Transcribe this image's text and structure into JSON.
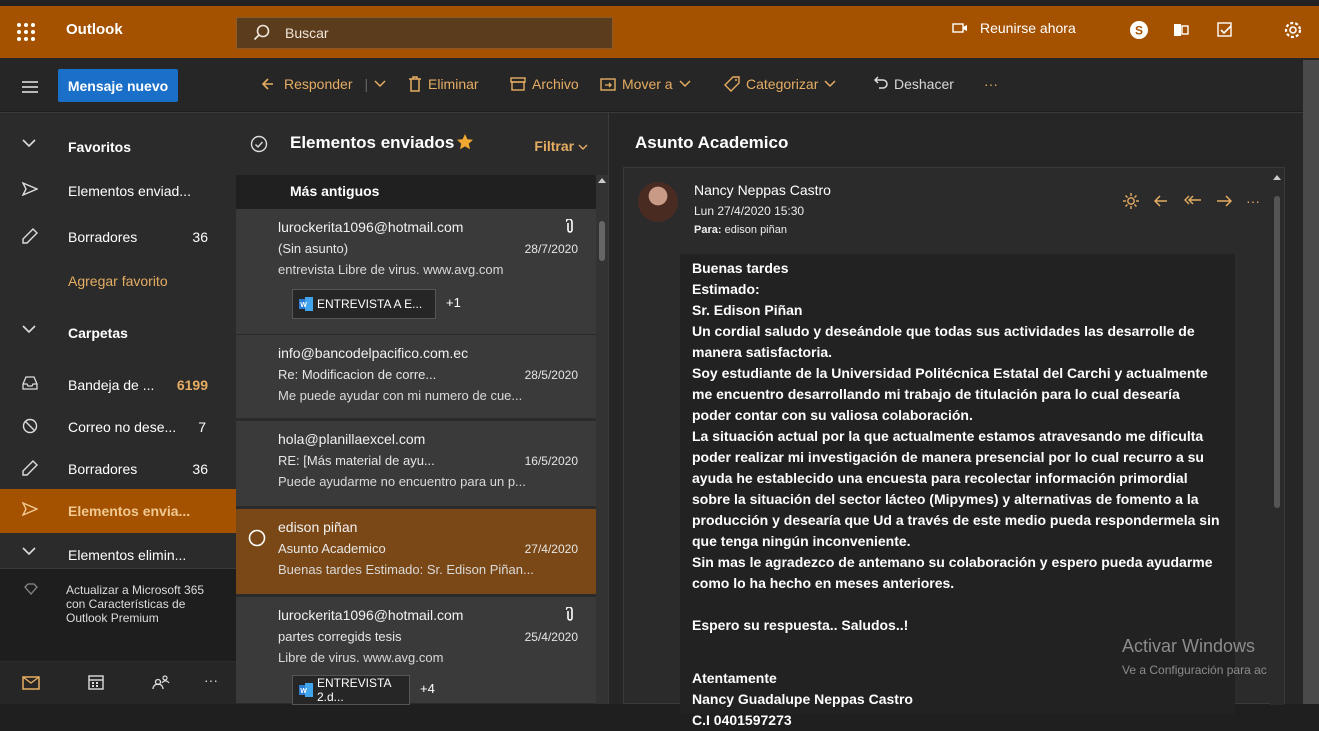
{
  "app": {
    "brand": "Outlook"
  },
  "search": {
    "placeholder": "Buscar"
  },
  "topbar": {
    "meet_label": "Reunirse ahora",
    "icons": [
      "meet-now-icon",
      "skype-icon",
      "office-icon",
      "my-day-icon",
      "settings-icon"
    ]
  },
  "commands": {
    "new_message": "Mensaje nuevo",
    "reply": "Responder",
    "delete": "Eliminar",
    "archive": "Archivo",
    "move_to": "Mover a",
    "categorize": "Categorizar",
    "undo": "Deshacer",
    "more": "···"
  },
  "sidebar": {
    "favorites_label": "Favoritos",
    "favorites": [
      {
        "label": "Elementos enviad...",
        "count": "",
        "icon": "send-icon"
      },
      {
        "label": "Borradores",
        "count": "36",
        "icon": "pencil-icon"
      }
    ],
    "add_favorite": "Agregar favorito",
    "folders_label": "Carpetas",
    "folders": [
      {
        "label": "Bandeja de ...",
        "count": "6199",
        "icon": "inbox-icon"
      },
      {
        "label": "Correo no dese...",
        "count": "7",
        "icon": "junk-icon"
      },
      {
        "label": "Borradores",
        "count": "36",
        "icon": "pencil-icon"
      },
      {
        "label": "Elementos envia...",
        "count": "",
        "icon": "send-icon"
      },
      {
        "label": "Elementos elimin...",
        "count": "",
        "icon": "chevron-down-icon"
      }
    ],
    "upgrade_text": "Actualizar a Microsoft 365 con Características de Outlook Premium"
  },
  "list": {
    "title": "Elementos enviados",
    "filter": "Filtrar",
    "group": "Más antiguos",
    "messages": [
      {
        "from": "lurockerita1096@hotmail.com",
        "subject": "(Sin asunto)",
        "date": "28/7/2020",
        "preview": "entrevista Libre de virus. www.avg.com",
        "attachment": "ENTREVISTA A E...",
        "more": "+1"
      },
      {
        "from": "info@bancodelpacifico.com.ec",
        "subject": "Re: Modificacion de corre...",
        "date": "28/5/2020",
        "preview": "Me puede ayudar con mi numero de cue..."
      },
      {
        "from": "hola@planillaexcel.com",
        "subject": "RE: [Más material de ayu...",
        "date": "16/5/2020",
        "preview": "Puede ayudarme no encuentro para un p..."
      },
      {
        "from": "edison piñan",
        "subject": "Asunto Academico",
        "date": "27/4/2020",
        "preview": "Buenas tardes Estimado: Sr. Edison Piñan..."
      },
      {
        "from": "lurockerita1096@hotmail.com",
        "subject": "partes corregids tesis",
        "date": "25/4/2020",
        "preview": "Libre de virus. www.avg.com",
        "attachment": "ENTREVISTA 2.d...",
        "more": "+4"
      }
    ]
  },
  "reading": {
    "subject": "Asunto Academico",
    "sender": "Nancy Neppas Castro",
    "datetime": "Lun 27/4/2020 15:30",
    "to_label": "Para:",
    "to": "edison piñan",
    "body": [
      "Buenas tardes",
      "Estimado:",
      "Sr. Edison Piñan",
      "Un cordial saludo y deseándole que todas sus actividades las desarrolle de",
      "manera satisfactoria.",
      "Soy estudiante de la Universidad Politécnica Estatal del Carchi y actualmente",
      "me encuentro desarrollando mi trabajo de titulación para lo cual desearía",
      "poder contar con su valiosa colaboración.",
      "La situación actual por la que actualmente estamos atravesando me dificulta",
      "poder realizar mi investigación de manera presencial por lo cual recurro a su",
      "ayuda he establecido una encuesta para recolectar información primordial",
      "sobre la situación del sector lácteo (Mipymes) y alternativas de fomento a la",
      "producción y desearía que Ud a través de este medio pueda respondermela sin",
      "que tenga ningún inconveniente.",
      "Sin mas le agradezco de antemano su colaboración y espero pueda ayudarme",
      "como lo ha hecho en meses anteriores.",
      "",
      "Espero su respuesta.. Saludos..!",
      "",
      "Atentamente",
      "Nancy Guadalupe Neppas Castro",
      "C.I 0401597273"
    ]
  },
  "watermark": {
    "line1": "Activar Windows",
    "line2": "Ve a Configuración para ac"
  },
  "colors": {
    "accent": "#a45200",
    "primary": "#1a6fc9",
    "command_text": "#e6ad62"
  }
}
